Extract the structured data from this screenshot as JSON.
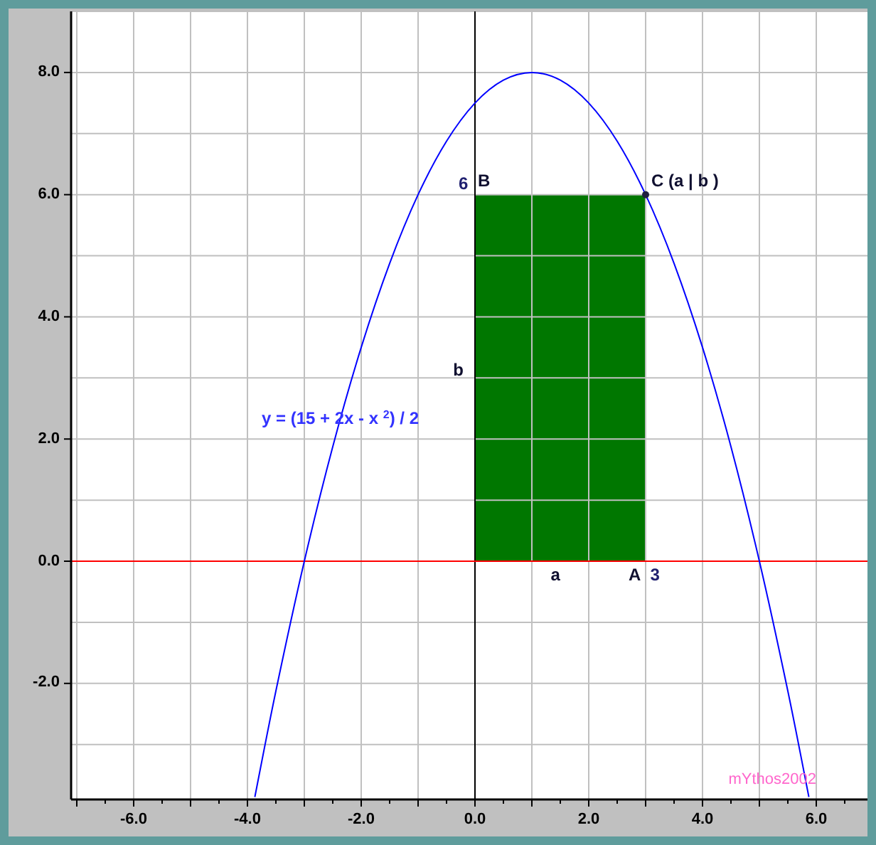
{
  "plot": {
    "chart_data": {
      "type": "line",
      "xlim": [
        -7.1,
        6.9
      ],
      "ylim": [
        -3.9,
        9
      ],
      "grid": true,
      "xticks": [
        {
          "value": -6,
          "label": "-6.0"
        },
        {
          "value": -4,
          "label": "-4.0"
        },
        {
          "value": -2,
          "label": "-2.0"
        },
        {
          "value": 0,
          "label": "0.0"
        },
        {
          "value": 2,
          "label": "2.0"
        },
        {
          "value": 4,
          "label": "4.0"
        },
        {
          "value": 6,
          "label": "6.0"
        }
      ],
      "yticks": [
        {
          "value": -2,
          "label": "-2.0"
        },
        {
          "value": 0,
          "label": "0.0"
        },
        {
          "value": 2,
          "label": "2.0"
        },
        {
          "value": 4,
          "label": "4.0"
        },
        {
          "value": 6,
          "label": "6.0"
        },
        {
          "value": 8,
          "label": "8.0"
        }
      ],
      "x": [
        -3.87,
        -3.5,
        -3,
        -2.5,
        -2,
        -1.5,
        -1,
        -0.5,
        0,
        0.5,
        1,
        1.5,
        2,
        2.5,
        3,
        3.5,
        4,
        4.5,
        5,
        5.5,
        5.87
      ],
      "series": [
        {
          "type": "area",
          "color": "#007700",
          "values": [
            null,
            null,
            null,
            null,
            null,
            null,
            null,
            null,
            6,
            6,
            6,
            6,
            6,
            6,
            6,
            null,
            null,
            null,
            null,
            null,
            null
          ]
        },
        {
          "name": "y = (15 + 2x - x $^{2}$) / 2",
          "color": "#0000ff",
          "values": [
            -3.86,
            -2.125,
            0,
            1.875,
            3.5,
            4.875,
            6,
            6.875,
            7.5,
            7.875,
            8,
            7.875,
            7.5,
            6.875,
            6,
            4.875,
            3.5,
            1.875,
            0,
            -2.125,
            -3.86
          ]
        },
        {
          "name": "C (a | b )",
          "color": "#202040",
          "marker": "circle",
          "values": [
            null,
            null,
            null,
            null,
            null,
            null,
            null,
            null,
            null,
            null,
            null,
            null,
            null,
            null,
            6,
            null,
            null,
            null,
            null,
            null,
            null
          ]
        }
      ],
      "ref_lines": [
        {
          "axis": "y",
          "value": 0,
          "color": "#ff0000"
        }
      ]
    },
    "labels": [
      "6",
      "B",
      "b",
      "a",
      "A",
      "3"
    ]
  },
  "signature": "mYthos2002"
}
